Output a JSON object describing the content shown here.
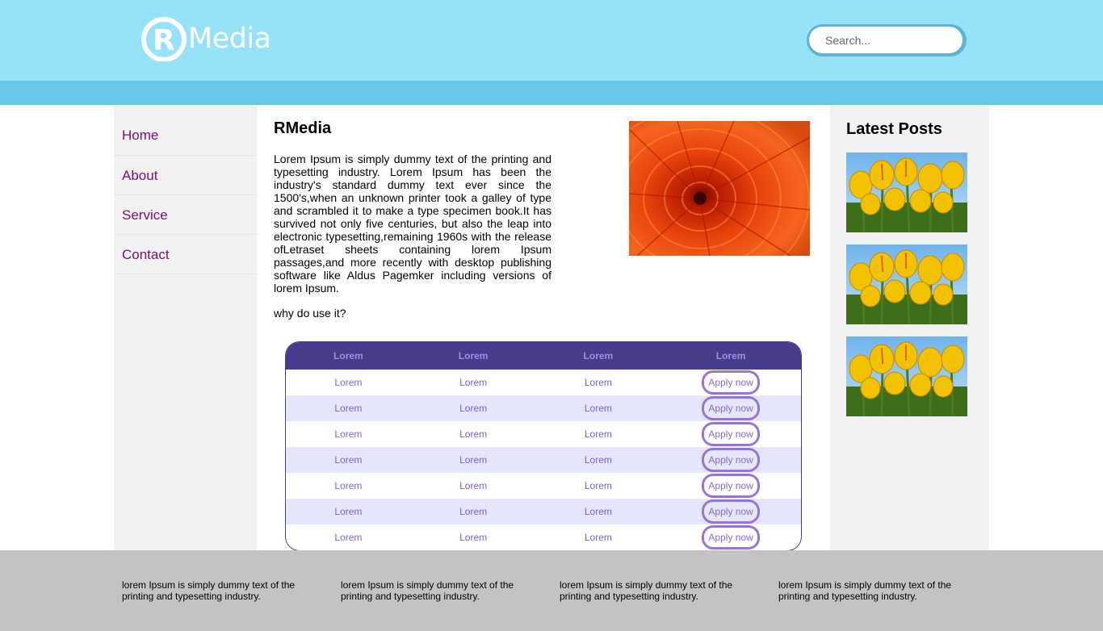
{
  "header": {
    "logo_text": "Media",
    "logo_mark": "R",
    "search_placeholder": "Search..."
  },
  "nav": {
    "items": [
      {
        "label": "Home"
      },
      {
        "label": "About"
      },
      {
        "label": "Service"
      },
      {
        "label": "Contact"
      }
    ]
  },
  "main": {
    "title": "RMedia",
    "body": "Lorem Ipsum is simply dummy text of the printing and typesetting industry. Lorem Ipsum has been the industry's standard dummy text ever since the 1500's,when an unknown printer took a galley of type and scrambled it to make a type specimen book.It has survived not only five centuries, but also the leap into electronic typesetting,remaining 1960s with the release ofLetraset sheets containing lorem Ipsum passages,and more recently with desktop publishing software like Aldus Pagemker including versions of lorem Ipsum.",
    "subheading": "why do use it?"
  },
  "table": {
    "headers": [
      "Lorem",
      "Lorem",
      "Lorem",
      "Lorem"
    ],
    "rows": [
      [
        "Lorem",
        "Lorem",
        "Lorem",
        "Apply now"
      ],
      [
        "Lorem",
        "Lorem",
        "Lorem",
        "Apply now"
      ],
      [
        "Lorem",
        "Lorem",
        "Lorem",
        "Apply now"
      ],
      [
        "Lorem",
        "Lorem",
        "Lorem",
        "Apply now"
      ],
      [
        "Lorem",
        "Lorem",
        "Lorem",
        "Apply now"
      ],
      [
        "Lorem",
        "Lorem",
        "Lorem",
        "Apply now"
      ],
      [
        "Lorem",
        "Lorem",
        "Lorem",
        "Apply now"
      ]
    ]
  },
  "latest": {
    "title": "Latest Posts"
  },
  "footer": {
    "columns": [
      "lorem Ipsum is simply dummy text of the printing and typesetting industry.",
      "lorem Ipsum is simply dummy text of the printing and typesetting industry.",
      "lorem Ipsum is simply dummy text of the printing and typesetting industry.",
      "lorem Ipsum is simply dummy text of the printing and typesetting industry."
    ]
  },
  "colors": {
    "header_bg": "#96e2f8",
    "header_strip": "#67c5e6",
    "nav_text": "#7a0e73",
    "table_head": "#473b8d",
    "table_alt_row": "#e6e6fa",
    "footer_bg": "#c3c3c3"
  }
}
